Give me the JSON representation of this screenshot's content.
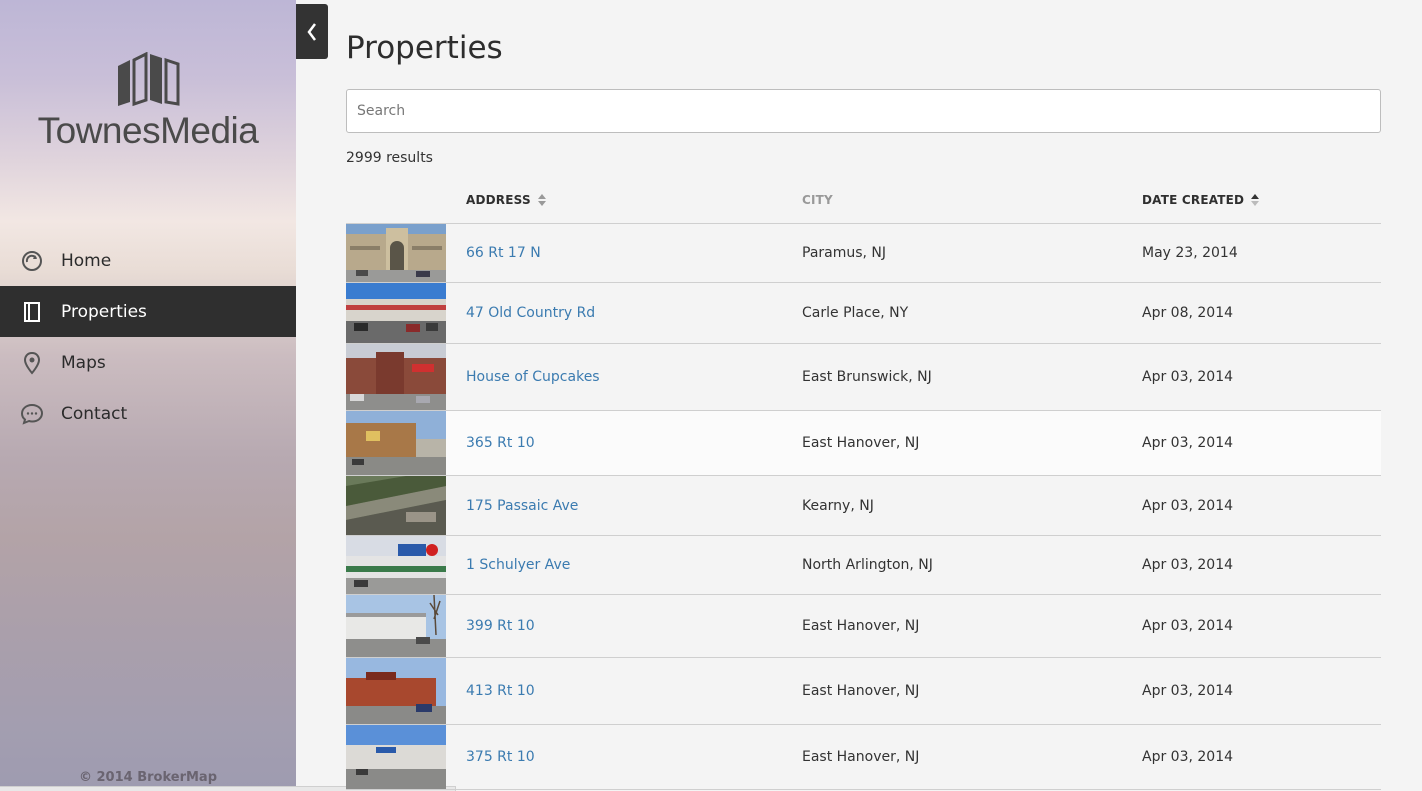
{
  "brand": {
    "name": "TownesMedia",
    "copyright": "© 2014 BrokerMap"
  },
  "nav": [
    {
      "label": "Home",
      "icon": "home-refresh-icon",
      "active": false
    },
    {
      "label": "Properties",
      "icon": "document-icon",
      "active": true
    },
    {
      "label": "Maps",
      "icon": "map-pin-icon",
      "active": false
    },
    {
      "label": "Contact",
      "icon": "chat-bubble-icon",
      "active": false
    }
  ],
  "page": {
    "title": "Properties",
    "search_placeholder": "Search",
    "results_text": "2999 results"
  },
  "table": {
    "columns": [
      "ADDRESS",
      "CITY",
      "DATE CREATED"
    ],
    "rows": [
      {
        "address": "66 Rt 17 N",
        "city": "Paramus, NJ",
        "date": "May 23, 2014"
      },
      {
        "address": "47 Old Country Rd",
        "city": "Carle Place, NY",
        "date": "Apr 08, 2014"
      },
      {
        "address": "House of Cupcakes",
        "city": "East Brunswick, NJ",
        "date": "Apr 03, 2014"
      },
      {
        "address": "365 Rt 10",
        "city": "East Hanover, NJ",
        "date": "Apr 03, 2014"
      },
      {
        "address": "175 Passaic Ave",
        "city": "Kearny, NJ",
        "date": "Apr 03, 2014"
      },
      {
        "address": "1 Schulyer Ave",
        "city": "North Arlington, NJ",
        "date": "Apr 03, 2014"
      },
      {
        "address": "399 Rt 10",
        "city": "East Hanover, NJ",
        "date": "Apr 03, 2014"
      },
      {
        "address": "413 Rt 10",
        "city": "East Hanover, NJ",
        "date": "Apr 03, 2014"
      },
      {
        "address": "375 Rt 10",
        "city": "East Hanover, NJ",
        "date": "Apr 03, 2014"
      }
    ]
  },
  "colors": {
    "link": "#3b7bb0",
    "active_nav": "#2f2f2f"
  }
}
